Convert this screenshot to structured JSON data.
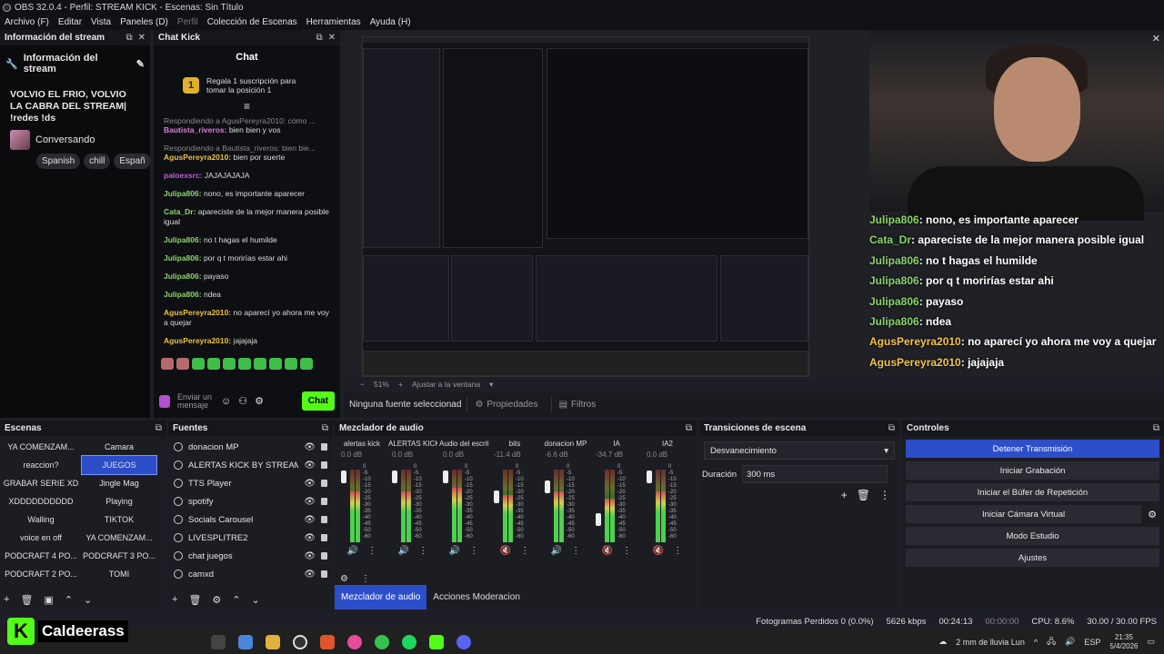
{
  "window": {
    "title": "OBS 32.0.4 - Perfil: STREAM KICK - Escenas: Sin Título"
  },
  "menu": [
    {
      "label": "Archivo (F)",
      "dim": false
    },
    {
      "label": "Editar",
      "dim": false
    },
    {
      "label": "Vista",
      "dim": false
    },
    {
      "label": "Paneles (D)",
      "dim": false
    },
    {
      "label": "Perfil",
      "dim": true
    },
    {
      "label": "Colección de Escenas",
      "dim": false
    },
    {
      "label": "Herramientas",
      "dim": false
    },
    {
      "label": "Ayuda (H)",
      "dim": false
    }
  ],
  "stream_info": {
    "dock_title": "Información del stream",
    "heading": "Información del stream",
    "title": "VOLVIO EL FRIO, VOLVIO LA CABRA DEL STREAM| !redes !ds",
    "category": "Conversando",
    "tags": [
      "Spanish",
      "chill",
      "Españ"
    ]
  },
  "chat": {
    "dock_title": "Chat Kick",
    "header": "Chat",
    "sub_promo": "Regala 1 suscripción para tomar la posición 1",
    "messages": [
      {
        "reply": "Respondiendo a AgusPereyra2010: cómo ...",
        "user": "Bautista_riveros:",
        "color": "#e07ad8",
        "text": " bien bien y vos"
      },
      {
        "reply": "Respondiendo a Bautista_riveros: bien bie...",
        "user": "AgusPereyra2010:",
        "color": "#e9c24c",
        "text": " bien por suerte"
      },
      {
        "reply": "",
        "user": "paloexsrc:",
        "color": "#c05ce0",
        "text": " JAJAJAJAJA"
      },
      {
        "reply": "",
        "user": "Julipa806:",
        "color": "#8bd36a",
        "text": " nono, es importante aparecer"
      },
      {
        "reply": "",
        "user": "Cata_Dr:",
        "color": "#8bd36a",
        "text": " apareciste de la mejor manera posible igual"
      },
      {
        "reply": "",
        "user": "Julipa806:",
        "color": "#8bd36a",
        "text": " no t hagas el humilde"
      },
      {
        "reply": "",
        "user": "Julipa806:",
        "color": "#8bd36a",
        "text": " por q t morirías estar ahi"
      },
      {
        "reply": "",
        "user": "Julipa806:",
        "color": "#8bd36a",
        "text": " payaso"
      },
      {
        "reply": "",
        "user": "Julipa806:",
        "color": "#8bd36a",
        "text": " ndea"
      },
      {
        "reply": "",
        "user": "AgusPereyra2010:",
        "color": "#e9c24c",
        "text": " no aparecí yo ahora me voy a quejar"
      },
      {
        "reply": "",
        "user": "AgusPereyra2010:",
        "color": "#e9c24c",
        "text": " jajajaja"
      }
    ],
    "input_placeholder": "Enviar un mensaje",
    "send_label": "Chat"
  },
  "overlay_chat": [
    {
      "user": "Julipa806",
      "text": ": nono, es importante aparecer",
      "gold": false
    },
    {
      "user": "Cata_Dr",
      "text": ": apareciste de la mejor manera posible igual",
      "gold": false
    },
    {
      "user": "Julipa806",
      "text": ": no t hagas el humilde",
      "gold": false
    },
    {
      "user": "Julipa806",
      "text": ": por q t morirías estar ahi",
      "gold": false
    },
    {
      "user": "Julipa806",
      "text": ": payaso",
      "gold": false
    },
    {
      "user": "Julipa806",
      "text": ": ndea",
      "gold": false
    },
    {
      "user": "AgusPereyra2010",
      "text": ": no aparecí yo ahora me voy a quejar",
      "gold": true
    },
    {
      "user": "AgusPereyra2010",
      "text": ": jajajaja",
      "gold": true
    }
  ],
  "preview_bar": {
    "zoom": "51%",
    "fit": "Ajustar a la ventana"
  },
  "source_bar": {
    "selected": "Ninguna fuente seleccionad",
    "properties": "Propiedades",
    "filters": "Filtros"
  },
  "scenes": {
    "title": "Escenas",
    "items": [
      "YA COMENZAM...",
      "Camara",
      "reaccion?",
      "JUEGOS",
      "GRABAR SERIE XD",
      "Jingle Mag",
      "XDDDDDDDDDD",
      "Playing",
      "Walling",
      "TIKTOK",
      "voice en off",
      "YA COMENZAM...",
      "PODCRAFT 4 PO...",
      "PODCRAFT 3 PO...",
      "PODCRAFT 2 PO...",
      "TOMI"
    ],
    "selected": "JUEGOS"
  },
  "sources": {
    "title": "Fuentes",
    "items": [
      "donacion MP",
      "ALERTAS KICK BY STREAMEL",
      "TTS Player",
      "spotify",
      "Socials Carousel",
      "LIVESPLITRE2",
      "chat juegos",
      "camxd"
    ]
  },
  "mixer": {
    "title": "Mezclador de audio",
    "channels": [
      {
        "name": "alertas kick",
        "db": "0.0 dB",
        "level": 0.7,
        "fader": 0.9,
        "muted": false
      },
      {
        "name": "ALERTAS KICK BY S",
        "db": "0.0 dB",
        "level": 0.7,
        "fader": 0.9,
        "muted": false
      },
      {
        "name": "Audio del escritorio",
        "db": "0.0 dB",
        "level": 0.75,
        "fader": 0.9,
        "muted": false
      },
      {
        "name": "bits",
        "db": "-11.4 dB",
        "level": 0.65,
        "fader": 0.6,
        "muted": true
      },
      {
        "name": "donacion MP",
        "db": "-6.6 dB",
        "level": 0.7,
        "fader": 0.75,
        "muted": false
      },
      {
        "name": "IA",
        "db": "-34.7 dB",
        "level": 0.6,
        "fader": 0.25,
        "muted": true
      },
      {
        "name": "IA2",
        "db": "0.0 dB",
        "level": 0.7,
        "fader": 0.9,
        "muted": true
      }
    ],
    "tabs": [
      "Mezclador de audio",
      "Acciones Moderacion"
    ]
  },
  "transitions": {
    "title": "Transiciones de escena",
    "selected": "Desvanecimiento",
    "duration_label": "Duración",
    "duration": "300 ms"
  },
  "controls": {
    "title": "Controles",
    "buttons": [
      "Detener Transmisión",
      "Iniciar Grabación",
      "Iniciar el Búfer de Repetición",
      "Iniciar Cámara Virtual",
      "Modo Estudio",
      "Ajustes"
    ]
  },
  "status": {
    "dropped": "Fotogramas Perdidos 0 (0.0%)",
    "bitrate": "5626 kbps",
    "stream_time": "00:24:13",
    "rec_time": "00:00:00",
    "cpu": "CPU: 8.6%",
    "fps": "30.00 / 30.00 FPS"
  },
  "taskbar": {
    "logo_text": "Caldeerass",
    "weather": "2 mm de lluvia Lun",
    "lang": "ESP",
    "time": "21:35",
    "date": "5/4/2026"
  }
}
